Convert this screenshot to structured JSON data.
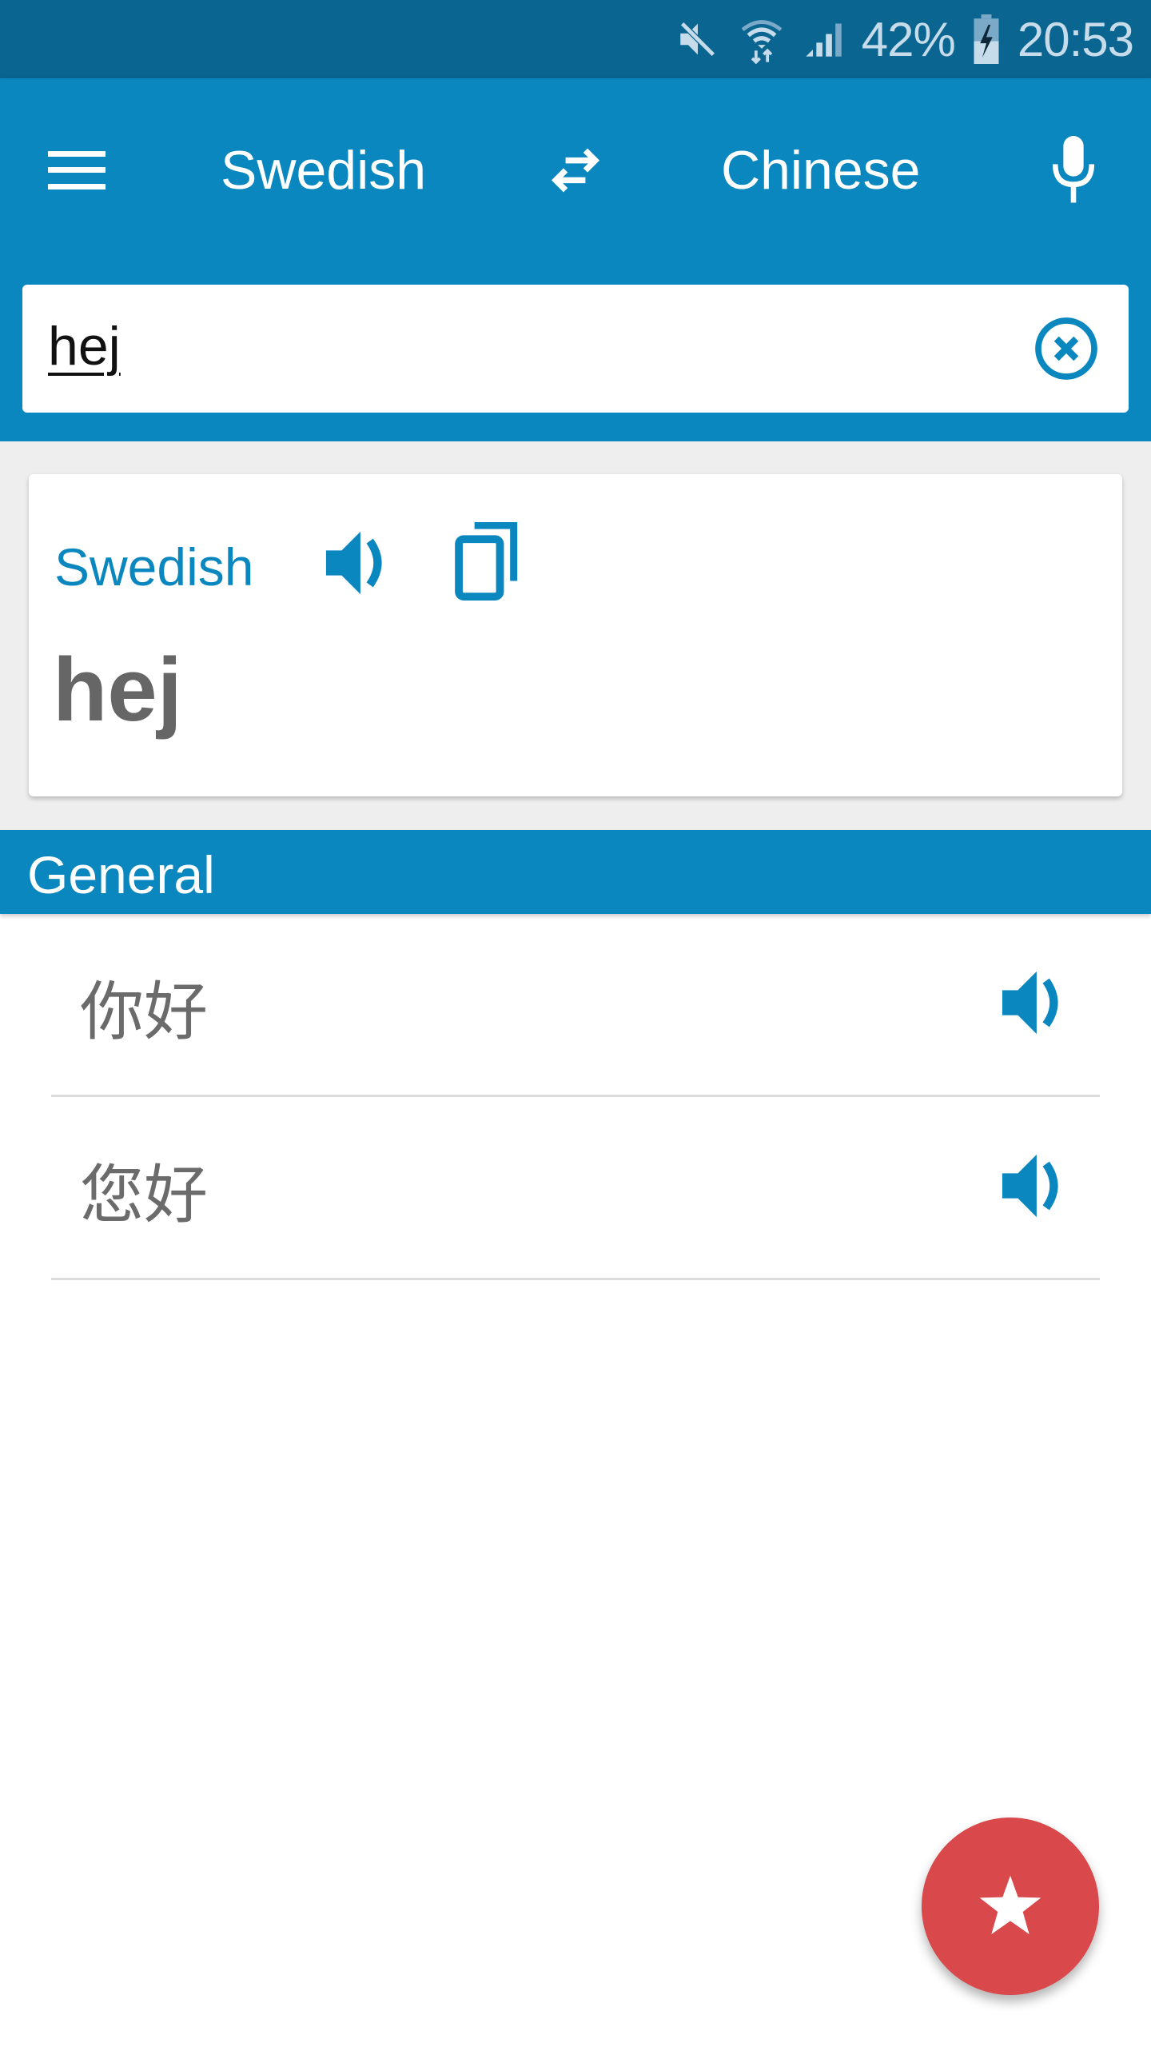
{
  "status_bar": {
    "battery_percent": "42%",
    "time": "20:53",
    "icons": [
      "mute-icon",
      "wifi-icon",
      "signal-icon",
      "battery-charging-icon"
    ]
  },
  "toolbar": {
    "menu_icon": "hamburger-menu-icon",
    "source_language": "Swedish",
    "swap_icon": "swap-arrows-icon",
    "target_language": "Chinese",
    "mic_icon": "microphone-icon"
  },
  "search": {
    "value": "hej",
    "clear_icon": "clear-circle-icon"
  },
  "source_card": {
    "language": "Swedish",
    "speak_icon": "speaker-icon",
    "copy_icon": "copy-icon",
    "word": "hej"
  },
  "results": {
    "section_title": "General",
    "items": [
      {
        "text": "你好",
        "speak_icon": "speaker-icon"
      },
      {
        "text": "您好",
        "speak_icon": "speaker-icon"
      }
    ]
  },
  "fab": {
    "icon": "star-icon"
  },
  "colors": {
    "status_bar": "#0b6591",
    "primary": "#0b87c0",
    "fab": "#d9484a",
    "word_text": "#666666",
    "background": "#eeeeee"
  }
}
